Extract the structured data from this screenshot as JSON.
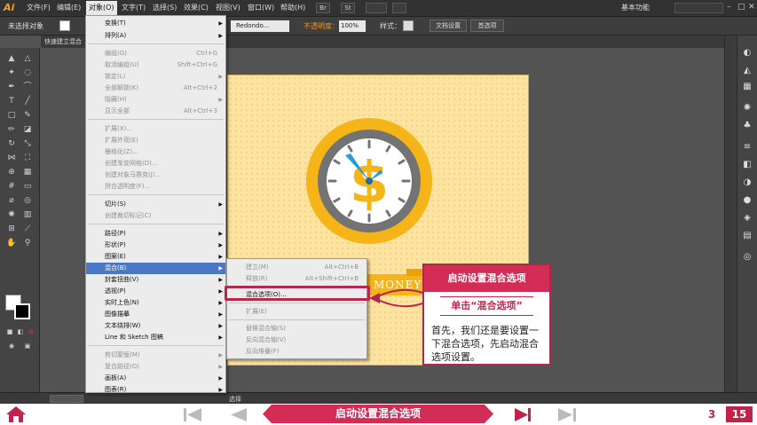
{
  "app": {
    "logo": "Ai"
  },
  "menubar": {
    "items": [
      "文件(F)",
      "编辑(E)",
      "对象(O)",
      "文字(T)",
      "选择(S)",
      "效果(C)",
      "视图(V)",
      "窗口(W)",
      "帮助(H)"
    ],
    "box_a": "Br",
    "box_b": "St",
    "workspace": "基本功能",
    "window_controls": [
      "–",
      "□",
      "✕"
    ]
  },
  "control_bar": {
    "no_selection": "未选择对象",
    "stroke_profile": "Redondo...",
    "opacity_label": "不透明度：",
    "opacity_value": "100%",
    "style_label": "样式：",
    "doc_setup": "文档设置",
    "preferences": "首选项"
  },
  "document_tab": {
    "label": "快速建立混合"
  },
  "object_menu": {
    "items": [
      {
        "label": "变换(T)",
        "shortcut": "",
        "arrow": "▶",
        "disabled": false
      },
      {
        "label": "排列(A)",
        "shortcut": "",
        "arrow": "▶",
        "disabled": false
      },
      {
        "label": "编组(G)",
        "shortcut": "Ctrl+G",
        "arrow": "",
        "disabled": true
      },
      {
        "label": "取消编组(U)",
        "shortcut": "Shift+Ctrl+G",
        "arrow": "",
        "disabled": true
      },
      {
        "label": "锁定(L)",
        "shortcut": "",
        "arrow": "▶",
        "disabled": true
      },
      {
        "label": "全部解锁(K)",
        "shortcut": "Alt+Ctrl+2",
        "arrow": "",
        "disabled": true
      },
      {
        "label": "隐藏(H)",
        "shortcut": "",
        "arrow": "▶",
        "disabled": true
      },
      {
        "label": "显示全部",
        "shortcut": "Alt+Ctrl+3",
        "arrow": "",
        "disabled": true
      },
      {
        "label": "扩展(X)...",
        "shortcut": "",
        "arrow": "",
        "disabled": true
      },
      {
        "label": "扩展外观(E)",
        "shortcut": "",
        "arrow": "",
        "disabled": true
      },
      {
        "label": "栅格化(Z)...",
        "shortcut": "",
        "arrow": "",
        "disabled": true
      },
      {
        "label": "创建渐变网格(D)...",
        "shortcut": "",
        "arrow": "",
        "disabled": true
      },
      {
        "label": "创建对象马赛克(J)...",
        "shortcut": "",
        "arrow": "",
        "disabled": true
      },
      {
        "label": "拼合透明度(F)...",
        "shortcut": "",
        "arrow": "",
        "disabled": true
      },
      {
        "label": "切片(S)",
        "shortcut": "",
        "arrow": "▶",
        "disabled": false
      },
      {
        "label": "创建裁切标记(C)",
        "shortcut": "",
        "arrow": "",
        "disabled": true
      },
      {
        "label": "路径(P)",
        "shortcut": "",
        "arrow": "▶",
        "disabled": false
      },
      {
        "label": "形状(P)",
        "shortcut": "",
        "arrow": "▶",
        "disabled": false
      },
      {
        "label": "图案(E)",
        "shortcut": "",
        "arrow": "▶",
        "disabled": false
      },
      {
        "label": "混合(B)",
        "shortcut": "",
        "arrow": "▶",
        "disabled": false,
        "highlight": true
      },
      {
        "label": "封套扭曲(V)",
        "shortcut": "",
        "arrow": "▶",
        "disabled": false
      },
      {
        "label": "透视(P)",
        "shortcut": "",
        "arrow": "▶",
        "disabled": false
      },
      {
        "label": "实时上色(N)",
        "shortcut": "",
        "arrow": "▶",
        "disabled": false
      },
      {
        "label": "图像描摹",
        "shortcut": "",
        "arrow": "▶",
        "disabled": false
      },
      {
        "label": "文本绕排(W)",
        "shortcut": "",
        "arrow": "▶",
        "disabled": false
      },
      {
        "label": "Line 和 Sketch 图稿",
        "shortcut": "",
        "arrow": "▶",
        "disabled": false
      },
      {
        "label": "剪切蒙版(M)",
        "shortcut": "",
        "arrow": "▶",
        "disabled": true
      },
      {
        "label": "复合路径(O)",
        "shortcut": "",
        "arrow": "▶",
        "disabled": true
      },
      {
        "label": "画板(A)",
        "shortcut": "",
        "arrow": "▶",
        "disabled": false
      },
      {
        "label": "图表(R)",
        "shortcut": "",
        "arrow": "▶",
        "disabled": false
      }
    ]
  },
  "blend_menu": {
    "items": [
      {
        "label": "建立(M)",
        "shortcut": "Alt+Ctrl+B",
        "disabled": true
      },
      {
        "label": "释放(R)",
        "shortcut": "Alt+Shift+Ctrl+B",
        "disabled": true
      },
      {
        "label": "混合选项(O)...",
        "shortcut": "",
        "disabled": false
      },
      {
        "label": "扩展(E)",
        "shortcut": "",
        "disabled": true
      },
      {
        "label": "替换混合轴(S)",
        "shortcut": "",
        "disabled": true
      },
      {
        "label": "反向混合轴(V)",
        "shortcut": "",
        "disabled": true
      },
      {
        "label": "反向堆叠(F)",
        "shortcut": "",
        "disabled": true
      }
    ]
  },
  "artwork": {
    "symbol": "$",
    "banner_text": "MONEY"
  },
  "callout": {
    "title": "启动设置混合选项",
    "subtitle": "单击“混合选项”",
    "body": "首先，我们还是要设置一下混合选项，先启动混合选项设置。"
  },
  "status_bar": {
    "text": "选择"
  },
  "bottom_nav": {
    "title": "启动设置混合选项",
    "page_current": "3",
    "page_total": "15"
  },
  "colors": {
    "accent": "#c2224a",
    "menu_highlight": "#4b78c6",
    "artboard": "#fde3a0",
    "clock_ring": "#f5b418",
    "clock_bezel": "#737373"
  }
}
